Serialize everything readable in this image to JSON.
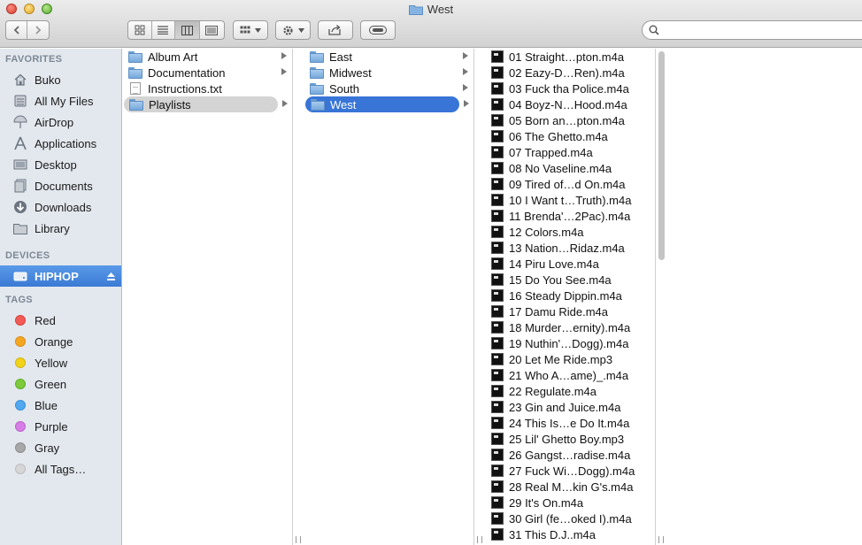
{
  "window": {
    "title": "West"
  },
  "sidebar": {
    "favorites_header": "FAVORITES",
    "favorites": [
      {
        "label": "Buko",
        "icon": "home-icon"
      },
      {
        "label": "All My Files",
        "icon": "all-files-icon"
      },
      {
        "label": "AirDrop",
        "icon": "airdrop-icon"
      },
      {
        "label": "Applications",
        "icon": "applications-icon"
      },
      {
        "label": "Desktop",
        "icon": "desktop-icon"
      },
      {
        "label": "Documents",
        "icon": "documents-icon"
      },
      {
        "label": "Downloads",
        "icon": "downloads-icon"
      },
      {
        "label": "Library",
        "icon": "folder-icon"
      }
    ],
    "devices_header": "DEVICES",
    "devices": [
      {
        "label": "HIPHOP",
        "icon": "drive-icon",
        "selected": true
      }
    ],
    "tags_header": "TAGS",
    "tags": [
      {
        "label": "Red",
        "color": "#f25b58"
      },
      {
        "label": "Orange",
        "color": "#f5a623"
      },
      {
        "label": "Yellow",
        "color": "#f2d31b"
      },
      {
        "label": "Green",
        "color": "#7ccb3d"
      },
      {
        "label": "Blue",
        "color": "#53a9ef"
      },
      {
        "label": "Purple",
        "color": "#d77ee6"
      },
      {
        "label": "Gray",
        "color": "#a8a8a8"
      },
      {
        "label": "All Tags…",
        "color": "#d6d6d6"
      }
    ]
  },
  "columns": {
    "col1": [
      {
        "label": "Album Art",
        "kind": "folder",
        "has_children": true
      },
      {
        "label": "Documentation",
        "kind": "folder",
        "has_children": true
      },
      {
        "label": "Instructions.txt",
        "kind": "file",
        "has_children": false
      },
      {
        "label": "Playlists",
        "kind": "folder",
        "has_children": true,
        "selected": "gray"
      }
    ],
    "col2": [
      {
        "label": "East",
        "kind": "folder",
        "has_children": true
      },
      {
        "label": "Midwest",
        "kind": "folder",
        "has_children": true
      },
      {
        "label": "South",
        "kind": "folder",
        "has_children": true
      },
      {
        "label": "West",
        "kind": "folder",
        "has_children": true,
        "selected": "blue"
      }
    ],
    "col3": [
      "01 Straight…pton.m4a",
      "02 Eazy-D…Ren).m4a",
      "03 Fuck tha Police.m4a",
      "04 Boyz-N…Hood.m4a",
      "05 Born an…pton.m4a",
      "06 The Ghetto.m4a",
      "07 Trapped.m4a",
      "08 No Vaseline.m4a",
      "09 Tired of…d On.m4a",
      "10 I Want t…Truth).m4a",
      "11 Brenda'…2Pac).m4a",
      "12 Colors.m4a",
      "13 Nation…Ridaz.m4a",
      "14 Piru Love.m4a",
      "15 Do You See.m4a",
      "16 Steady Dippin.m4a",
      "17 Damu Ride.m4a",
      "18 Murder…ernity).m4a",
      "19 Nuthin'…Dogg).m4a",
      "20 Let Me Ride.mp3",
      "21 Who A…ame)_.m4a",
      "22 Regulate.m4a",
      "23 Gin and Juice.m4a",
      "24 This Is…e Do It.m4a",
      "25 Lil' Ghetto Boy.mp3",
      "26 Gangst…radise.m4a",
      "27 Fuck Wi…Dogg).m4a",
      "28 Real M…kin G's.m4a",
      "29 It's On.m4a",
      "30 Girl (fe…oked I).m4a",
      "31 This D.J..m4a"
    ]
  }
}
